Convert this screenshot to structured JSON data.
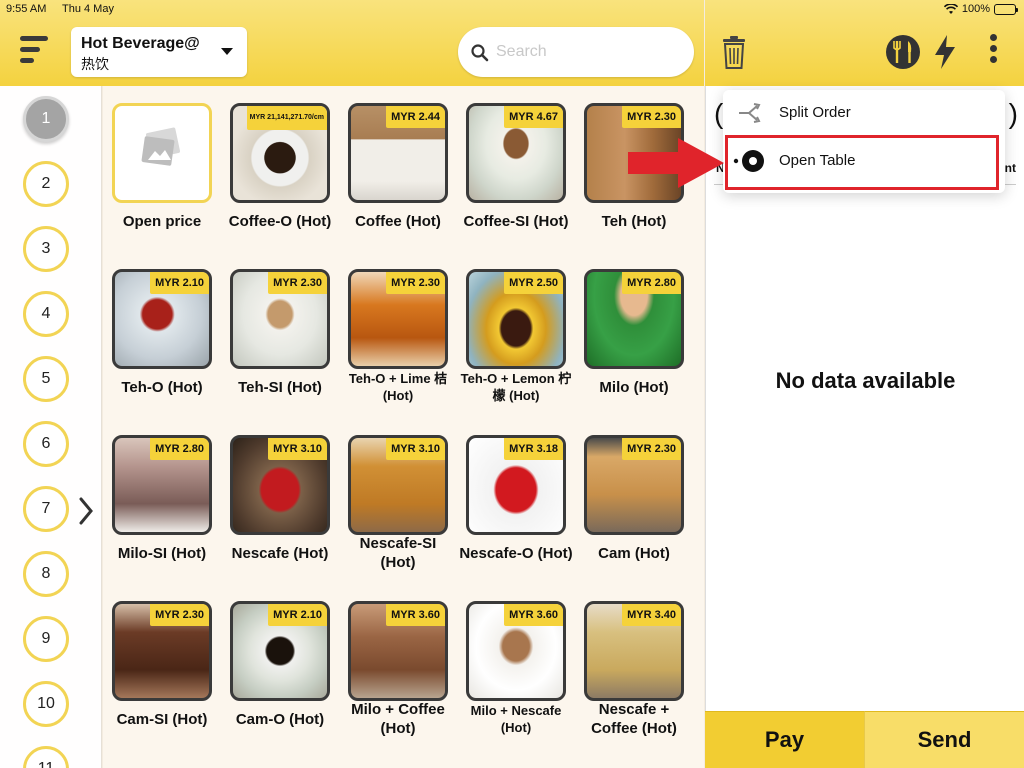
{
  "status_bar": {
    "time": "9:55 AM",
    "date": "Thu 4 May",
    "battery": "100%"
  },
  "header": {
    "category_name": "Hot Beverage@",
    "category_sub": "热饮",
    "search_placeholder": "Search"
  },
  "tables": [
    "1",
    "2",
    "3",
    "4",
    "5",
    "6",
    "7",
    "8",
    "9",
    "10",
    "11"
  ],
  "products": [
    {
      "name": "Open price",
      "price": ""
    },
    {
      "name": "Coffee-O (Hot)",
      "price": "MYR 21,141,271.70/cm"
    },
    {
      "name": "Coffee (Hot)",
      "price": "MYR 2.44"
    },
    {
      "name": "Coffee-SI (Hot)",
      "price": "MYR 4.67"
    },
    {
      "name": "Teh (Hot)",
      "price": "MYR 2.30"
    },
    {
      "name": "Teh-O (Hot)",
      "price": "MYR 2.10"
    },
    {
      "name": "Teh-SI (Hot)",
      "price": "MYR 2.30"
    },
    {
      "name": "Teh-O + Lime 桔 (Hot)",
      "price": "MYR 2.30"
    },
    {
      "name": "Teh-O + Lemon 柠檬 (Hot)",
      "price": "MYR 2.50"
    },
    {
      "name": "Milo (Hot)",
      "price": "MYR 2.80"
    },
    {
      "name": "Milo-SI (Hot)",
      "price": "MYR 2.80"
    },
    {
      "name": "Nescafe (Hot)",
      "price": "MYR 3.10"
    },
    {
      "name": "Nescafe-SI (Hot)",
      "price": "MYR 3.10"
    },
    {
      "name": "Nescafe-O (Hot)",
      "price": "MYR 3.18"
    },
    {
      "name": "Cam (Hot)",
      "price": "MYR 2.30"
    },
    {
      "name": "Cam-SI (Hot)",
      "price": "MYR 2.30"
    },
    {
      "name": "Cam-O (Hot)",
      "price": "MYR 2.10"
    },
    {
      "name": "Milo + Coffee (Hot)",
      "price": "MYR 3.60"
    },
    {
      "name": "Milo + Nescafe (Hot)",
      "price": "MYR 3.60"
    },
    {
      "name": "Nescafe + Coffee (Hot)",
      "price": "MYR 3.40"
    }
  ],
  "order_panel": {
    "empty_text": "No data available"
  },
  "menu": {
    "split_order": "Split Order",
    "open_table": "Open Table"
  },
  "footer": {
    "pay": "Pay",
    "send": "Send"
  },
  "colors": {
    "accent_yellow": "#f4d23f",
    "highlight_red": "#e0242b"
  }
}
